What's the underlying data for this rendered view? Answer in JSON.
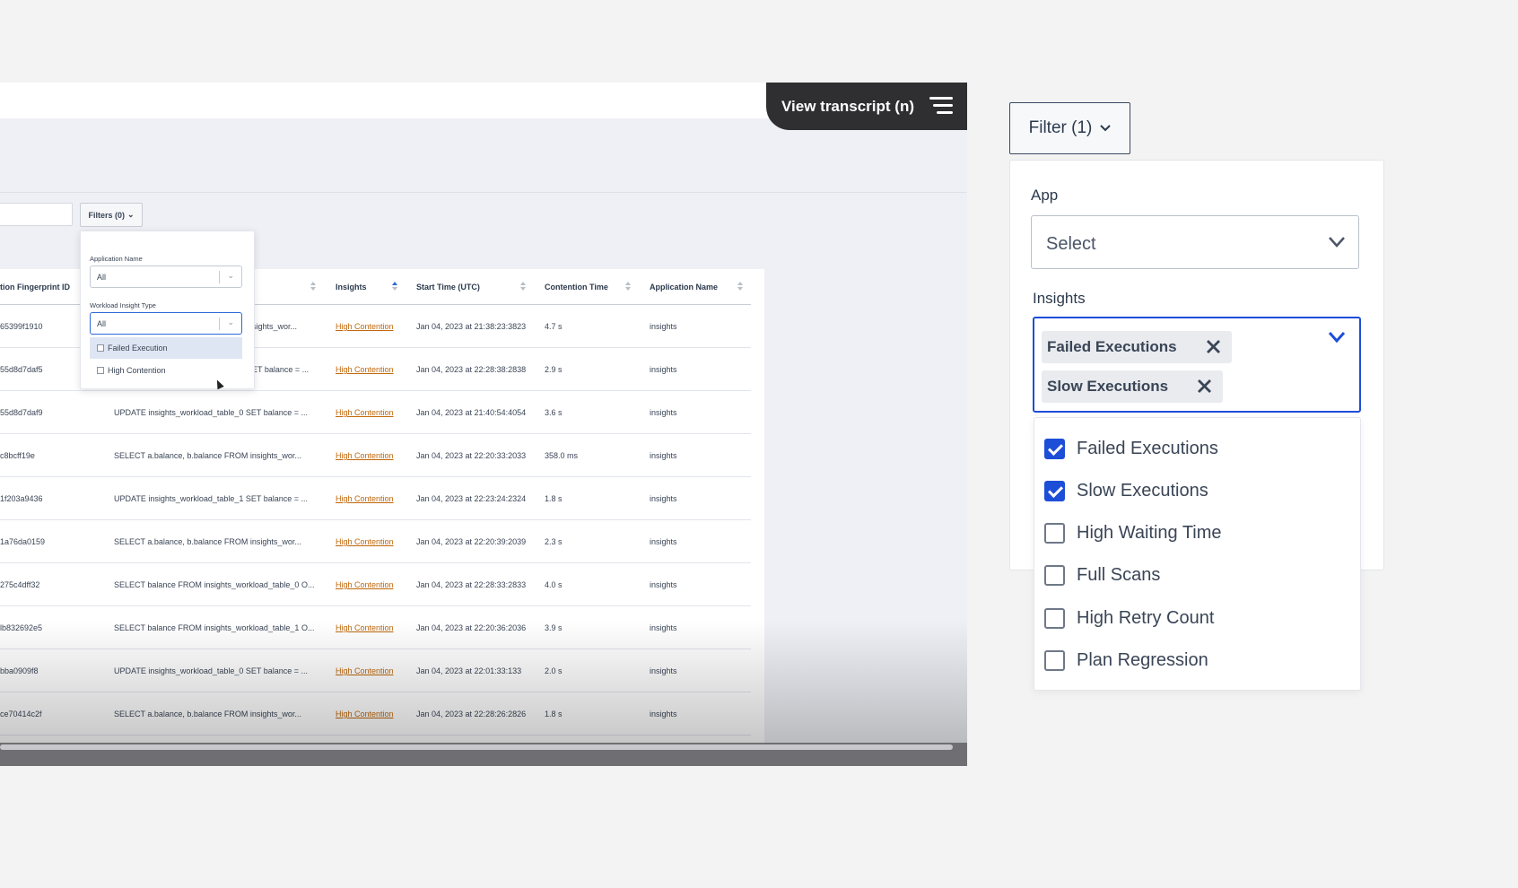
{
  "video": {
    "transcript_button": "View transcript (n)",
    "filters_button": "Filters (0)",
    "dropdown": {
      "app_name_label": "Application Name",
      "app_name_value": "All",
      "insight_type_label": "Workload Insight Type",
      "insight_type_value": "All",
      "options": [
        "Failed Execution",
        "High Contention"
      ]
    },
    "table": {
      "columns": [
        "tion Fingerprint ID",
        "Insights",
        "Start Time (UTC)",
        "Contention Time",
        "Application Name"
      ],
      "rows": [
        {
          "id": "65399f1910",
          "stmt": "sights_wor...",
          "insight": "High Contention",
          "start": "Jan 04, 2023 at 21:38:23:3823",
          "time": "4.7 s",
          "app": "insights"
        },
        {
          "id": "55d8d7daf5",
          "stmt": "ET balance = ...",
          "insight": "High Contention",
          "start": "Jan 04, 2023 at 22:28:38:2838",
          "time": "2.9 s",
          "app": "insights"
        },
        {
          "id": "55d8d7daf9",
          "stmt": "UPDATE insights_workload_table_0 SET balance = ...",
          "insight": "High Contention",
          "start": "Jan 04, 2023 at 21:40:54:4054",
          "time": "3.6 s",
          "app": "insights"
        },
        {
          "id": "c8bcff19e",
          "stmt": "SELECT a.balance, b.balance FROM insights_wor...",
          "insight": "High Contention",
          "start": "Jan 04, 2023 at 22:20:33:2033",
          "time": "358.0 ms",
          "app": "insights"
        },
        {
          "id": "1f203a9436",
          "stmt": "UPDATE insights_workload_table_1 SET balance = ...",
          "insight": "High Contention",
          "start": "Jan 04, 2023 at 22:23:24:2324",
          "time": "1.8 s",
          "app": "insights"
        },
        {
          "id": "1a76da0159",
          "stmt": "SELECT a.balance, b.balance FROM insights_wor...",
          "insight": "High Contention",
          "start": "Jan 04, 2023 at 22:20:39:2039",
          "time": "2.3 s",
          "app": "insights"
        },
        {
          "id": "275c4dff32",
          "stmt": "SELECT balance FROM insights_workload_table_0 O...",
          "insight": "High Contention",
          "start": "Jan 04, 2023 at 22:28:33:2833",
          "time": "4.0 s",
          "app": "insights"
        },
        {
          "id": "lb832692e5",
          "stmt": "SELECT balance FROM insights_workload_table_1 O...",
          "insight": "High Contention",
          "start": "Jan 04, 2023 at 22:20:36:2036",
          "time": "3.9 s",
          "app": "insights"
        },
        {
          "id": "bba0909f8",
          "stmt": "UPDATE insights_workload_table_0 SET balance = ...",
          "insight": "High Contention",
          "start": "Jan 04, 2023 at 22:01:33:133",
          "time": "2.0 s",
          "app": "insights"
        },
        {
          "id": "ce70414c2f",
          "stmt": "SELECT a.balance, b.balance FROM insights_wor...",
          "insight": "High Contention",
          "start": "Jan 04, 2023 at 22:28:26:2826",
          "time": "1.8 s",
          "app": "insights"
        }
      ]
    }
  },
  "filter": {
    "button_label": "Filter (1)",
    "app_label": "App",
    "app_placeholder": "Select",
    "insights_label": "Insights",
    "chips": [
      "Failed Executions",
      "Slow Executions"
    ],
    "options": [
      {
        "label": "Failed Executions",
        "checked": true
      },
      {
        "label": "Slow Executions",
        "checked": true
      },
      {
        "label": "High Waiting Time",
        "checked": false
      },
      {
        "label": "Full Scans",
        "checked": false
      },
      {
        "label": "High Retry Count",
        "checked": false
      },
      {
        "label": "Plan Regression",
        "checked": false
      }
    ]
  },
  "colors": {
    "accent": "#1d4ed8",
    "insight_text": "#c0670a",
    "transcript_bg": "#2f2f31"
  }
}
